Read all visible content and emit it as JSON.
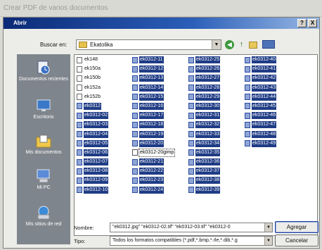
{
  "outer_window": {
    "title": "Crear PDF de varios documentos"
  },
  "dialog": {
    "title": "Abrir",
    "help_label": "?",
    "close_label": "X"
  },
  "toolbar": {
    "look_in_label": "Buscar en:",
    "look_in_value": "Ekatolika",
    "back_icon": "back-arrow-icon",
    "up_icon": "up-folder-icon",
    "new_folder_icon": "new-folder-icon",
    "views_icon": "views-menu-icon"
  },
  "places": [
    {
      "name": "place-recent",
      "label": "Documentos recientes",
      "icon": "recent-documents-icon"
    },
    {
      "name": "place-desktop",
      "label": "Escritorio",
      "icon": "desktop-icon"
    },
    {
      "name": "place-my-documents",
      "label": "Mis documentos",
      "icon": "my-documents-icon"
    },
    {
      "name": "place-my-pc",
      "label": "Mi PC",
      "icon": "my-computer-icon"
    },
    {
      "name": "place-network",
      "label": "Mis sitios de red",
      "icon": "network-places-icon"
    }
  ],
  "files": {
    "columns": [
      [
        {
          "name": "ek148",
          "selected": false
        },
        {
          "name": "ek150a",
          "selected": false
        },
        {
          "name": "ek150b",
          "selected": false
        },
        {
          "name": "ek152a",
          "selected": false
        },
        {
          "name": "ek152b",
          "selected": false
        },
        {
          "name": "ek0312",
          "selected": true
        },
        {
          "name": "ek0312-02",
          "selected": true
        },
        {
          "name": "ek0312-03",
          "selected": true
        },
        {
          "name": "ek0312-04",
          "selected": true
        },
        {
          "name": "ek0312-05",
          "selected": true
        },
        {
          "name": "ek0312-06",
          "selected": true
        },
        {
          "name": "ek0312-07",
          "selected": true
        },
        {
          "name": "ek0312-08",
          "selected": true
        },
        {
          "name": "ek0312-09",
          "selected": true
        },
        {
          "name": "ek0312-10",
          "selected": true
        }
      ],
      [
        {
          "name": "ek0312-11",
          "selected": true
        },
        {
          "name": "ek0312-12",
          "selected": true
        },
        {
          "name": "ek0312-13",
          "selected": true
        },
        {
          "name": "ek0312-14",
          "selected": true
        },
        {
          "name": "ek0312-15",
          "selected": true
        },
        {
          "name": "ek0312-16",
          "selected": true
        },
        {
          "name": "ek0312-17",
          "selected": true
        },
        {
          "name": "ek0312-18",
          "selected": true
        },
        {
          "name": "ek0312-19",
          "selected": true
        },
        {
          "name": "ek0312-20",
          "selected": true
        },
        {
          "name": "ek0312-20gimp",
          "selected": false,
          "focus": true
        },
        {
          "name": "ek0312-21",
          "selected": true
        },
        {
          "name": "ek0312-22",
          "selected": true
        },
        {
          "name": "ek0312-23",
          "selected": true
        },
        {
          "name": "ek0312-24",
          "selected": true
        }
      ],
      [
        {
          "name": "ek0312-25",
          "selected": true
        },
        {
          "name": "ek0312-26",
          "selected": true
        },
        {
          "name": "ek0312-27",
          "selected": true
        },
        {
          "name": "ek0312-28",
          "selected": true
        },
        {
          "name": "ek0312-29",
          "selected": true
        },
        {
          "name": "ek0312-30",
          "selected": true
        },
        {
          "name": "ek0312-31",
          "selected": true
        },
        {
          "name": "ek0312-32",
          "selected": true
        },
        {
          "name": "ek0312-33",
          "selected": true
        },
        {
          "name": "ek0312-34",
          "selected": true
        },
        {
          "name": "ek0312-35",
          "selected": true
        },
        {
          "name": "ek0312-36",
          "selected": true
        },
        {
          "name": "ek0312-37",
          "selected": true
        },
        {
          "name": "ek0312-38",
          "selected": true
        },
        {
          "name": "ek0312-39",
          "selected": true
        }
      ],
      [
        {
          "name": "ek0312-40",
          "selected": true
        },
        {
          "name": "ek0312-41",
          "selected": true
        },
        {
          "name": "ek0312-42",
          "selected": true
        },
        {
          "name": "ek0312-43",
          "selected": true
        },
        {
          "name": "ek0312-44",
          "selected": true
        },
        {
          "name": "ek0312-45",
          "selected": true
        },
        {
          "name": "ek0312-46",
          "selected": true
        },
        {
          "name": "ek0312-47",
          "selected": true
        },
        {
          "name": "ek0312-48",
          "selected": true
        },
        {
          "name": "ek0312-49",
          "selected": true
        }
      ]
    ]
  },
  "footer": {
    "name_label": "Nombre:",
    "name_value": "\"ek0312.jpg\" \"ek0312-02.tif\" \"ek0312-03.tif\" \"ek0312-0",
    "type_label": "Tipo:",
    "type_value": "Todos los formatos compatibles (*.pdf,*.bmp,*.rle,*.dib,*.g",
    "add_button": "Agregar",
    "cancel_button": "Cancelar"
  },
  "colors": {
    "selection": "#1f3c85",
    "title_bar": "#0b2a77",
    "places_bar": "#7f858c"
  }
}
